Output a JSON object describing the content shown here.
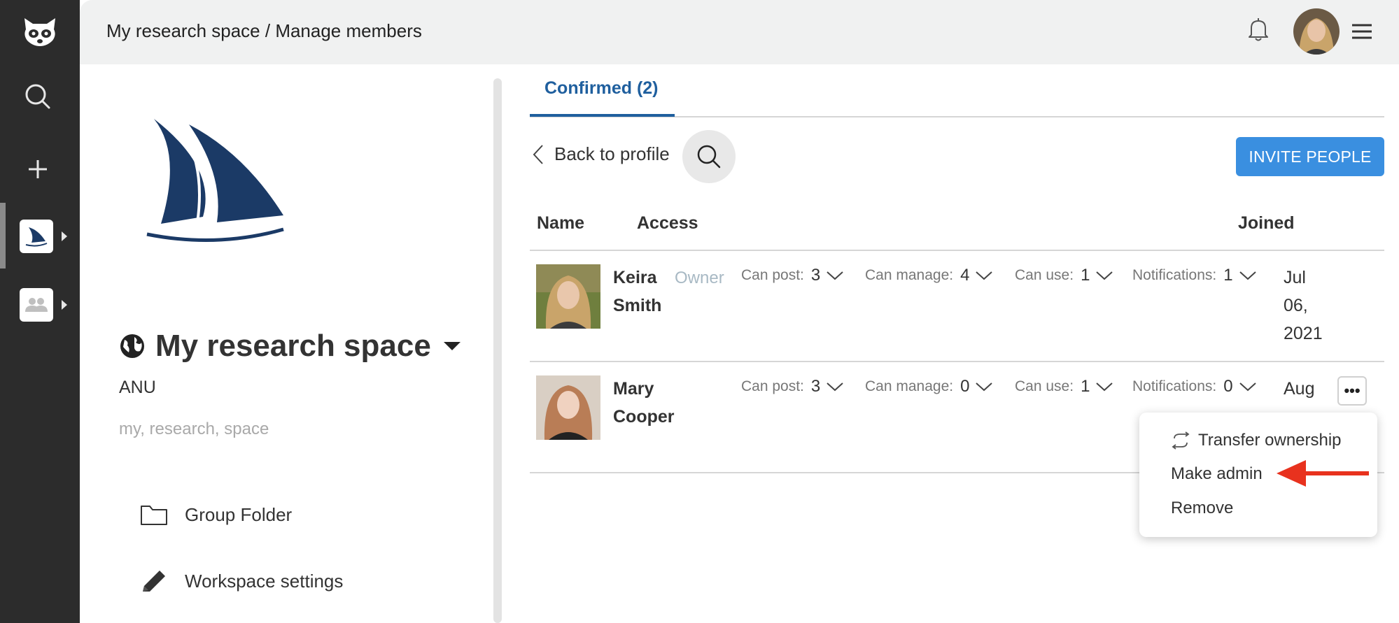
{
  "breadcrumb": "My research space / Manage members",
  "space": {
    "title": "My research space",
    "organization": "ANU",
    "tags": "my, research, space"
  },
  "nav": {
    "group_folder": "Group Folder",
    "workspace_settings": "Workspace settings"
  },
  "tabs": {
    "confirmed": "Confirmed (2)"
  },
  "toolbar": {
    "back_label": "Back to profile",
    "invite_label": "INVITE PEOPLE"
  },
  "table": {
    "headers": {
      "name": "Name",
      "access": "Access",
      "joined": "Joined"
    },
    "rows": [
      {
        "first": "Keira",
        "last": "Smith",
        "role": "Owner",
        "can_post_label": "Can post:",
        "can_post": "3",
        "can_manage_label": "Can manage:",
        "can_manage": "4",
        "can_use_label": "Can use:",
        "can_use": "1",
        "notifications_label": "Notifications:",
        "notifications": "1",
        "joined_1": "Jul",
        "joined_2": "06,",
        "joined_3": "2021"
      },
      {
        "first": "Mary",
        "last": "Cooper",
        "can_post_label": "Can post:",
        "can_post": "3",
        "can_manage_label": "Can manage:",
        "can_manage": "0",
        "can_use_label": "Can use:",
        "can_use": "1",
        "notifications_label": "Notifications:",
        "notifications": "0",
        "joined_1": "Aug"
      }
    ]
  },
  "more_button": "•••",
  "menu": {
    "transfer": "Transfer ownership",
    "make_admin": "Make admin",
    "remove": "Remove"
  },
  "colors": {
    "rail": "#2c2c2c",
    "accent_blue": "#1f5f9e",
    "invite_button": "#3a8fe0",
    "arrow_red": "#e8321e",
    "logo_navy": "#1b3a66"
  },
  "icons": [
    "raccoon-logo-icon",
    "search-icon",
    "plus-icon",
    "sailboat-icon",
    "group-icon",
    "bell-icon",
    "hamburger-menu-icon",
    "globe-icon",
    "folder-icon",
    "pencil-icon",
    "chevron-left-icon",
    "chevron-down-icon",
    "transfer-icon",
    "red-arrow-icon"
  ]
}
